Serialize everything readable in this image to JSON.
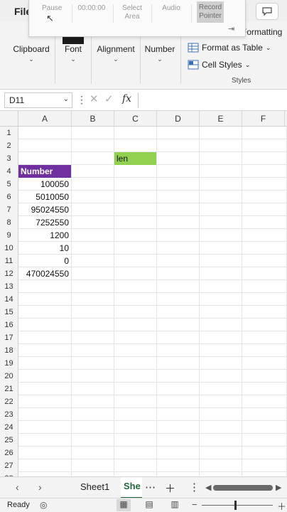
{
  "ribbon": {
    "file_tab": "File",
    "recorder": {
      "pause": "Pause",
      "timer": "00:00:00",
      "select_area": "Select\nArea",
      "audio": "Audio",
      "record_pointer": "Record\nPointer"
    },
    "groups": {
      "clipboard": "Clipboard",
      "font": "Font",
      "alignment": "Alignment",
      "number": "Number"
    },
    "styles": {
      "conditional_formatting": "Formatting",
      "format_as_table": "Format as Table",
      "cell_styles": "Cell Styles",
      "group_label": "Styles"
    }
  },
  "formula_bar": {
    "name_box": "D11",
    "fx_label": "fx",
    "formula": ""
  },
  "grid": {
    "columns": [
      "A",
      "B",
      "C",
      "D",
      "E",
      "F"
    ],
    "rows": [
      "1",
      "2",
      "3",
      "4",
      "5",
      "6",
      "7",
      "8",
      "9",
      "10",
      "11",
      "12",
      "13",
      "14",
      "15",
      "16",
      "17",
      "18",
      "19",
      "20",
      "21",
      "22",
      "23",
      "24",
      "25",
      "26",
      "27",
      "28"
    ],
    "cells": {
      "C3": "len",
      "A4": "Number",
      "A5": "100050",
      "A6": "5010050",
      "A7": "95024550",
      "A8": "7252550",
      "A9": "1200",
      "A10": "10",
      "A11": "0",
      "A12": "470024550"
    },
    "fill_colors": {
      "header_purple": "#7030a0",
      "len_green": "#92d050"
    }
  },
  "sheet_tabs": {
    "tabs": [
      "Sheet1",
      "She"
    ],
    "active_index": 1
  },
  "status": {
    "ready": "Ready"
  }
}
